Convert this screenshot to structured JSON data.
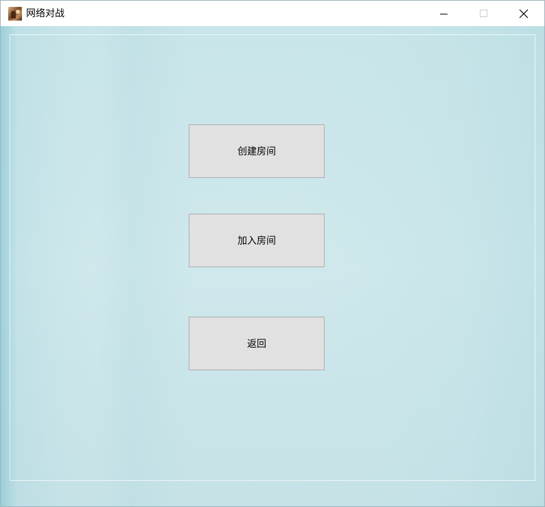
{
  "window": {
    "title": "网络对战",
    "icon": "app-avatar-icon",
    "controls": [
      "minimize-icon",
      "maximize-icon",
      "close-icon"
    ]
  },
  "menu": {
    "create_room_label": "创建房间",
    "join_room_label": "加入房间",
    "back_label": "返回"
  },
  "colors": {
    "background": "#cfe8ec",
    "button_face": "#e1e1e1",
    "button_border": "#adadad"
  }
}
